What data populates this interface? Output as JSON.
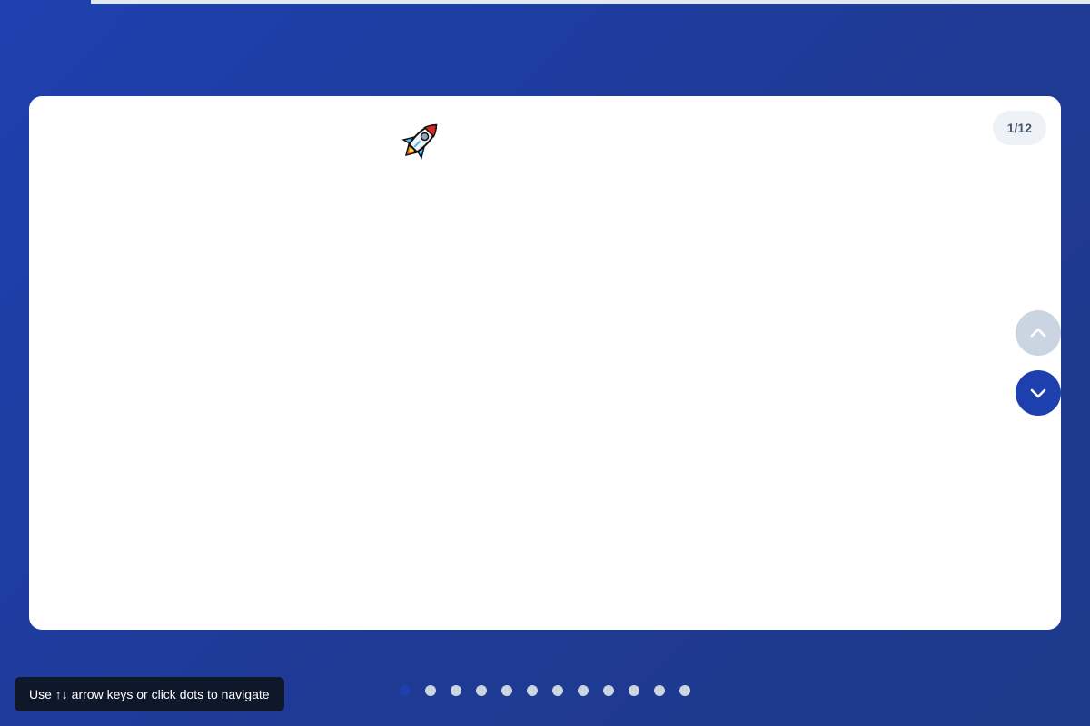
{
  "slide": {
    "emoji": "🚀",
    "counter": "1/12"
  },
  "navigation": {
    "up_icon": "chevron-up-icon",
    "down_icon": "chevron-down-icon",
    "current_slide": 1,
    "total_slides": 12,
    "hint": "Use ↑↓ arrow keys or click dots to navigate"
  },
  "progress": {
    "fraction": 0.0833
  },
  "colors": {
    "background": "#1e40af",
    "accent": "#1e40af",
    "inactive_dot": "#cbd5e1",
    "disabled_button": "#cbd5e1",
    "hint_background": "#0f172a"
  }
}
